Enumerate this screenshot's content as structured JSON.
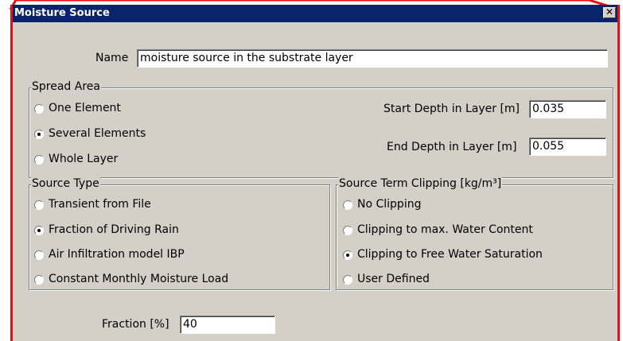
{
  "window": {
    "title": "Moisture Source",
    "close_glyph": "✕"
  },
  "name": {
    "label": "Name",
    "value": "moisture source in the substrate layer"
  },
  "spread_area": {
    "legend": "Spread Area",
    "options": [
      {
        "label": "One Element",
        "selected": false
      },
      {
        "label": "Several Elements",
        "selected": true
      },
      {
        "label": "Whole Layer",
        "selected": false
      }
    ],
    "start_depth": {
      "label": "Start Depth in Layer [m]",
      "value": "0.035"
    },
    "end_depth": {
      "label": "End Depth in Layer [m]",
      "value": "0.055"
    }
  },
  "source_type": {
    "legend": "Source Type",
    "options": [
      {
        "label": "Transient from File",
        "selected": false
      },
      {
        "label": "Fraction of Driving Rain",
        "selected": true
      },
      {
        "label": "Air Infiltration model IBP",
        "selected": false
      },
      {
        "label": "Constant Monthly Moisture Load",
        "selected": false
      }
    ]
  },
  "clipping": {
    "legend": "Source Term Clipping [kg/m³]",
    "options": [
      {
        "label": "No Clipping",
        "selected": false
      },
      {
        "label": "Clipping to max. Water Content",
        "selected": false
      },
      {
        "label": "Clipping to Free Water Saturation",
        "selected": true
      },
      {
        "label": "User Defined",
        "selected": false
      }
    ]
  },
  "fraction": {
    "label": "Fraction [%]",
    "value": "40"
  }
}
